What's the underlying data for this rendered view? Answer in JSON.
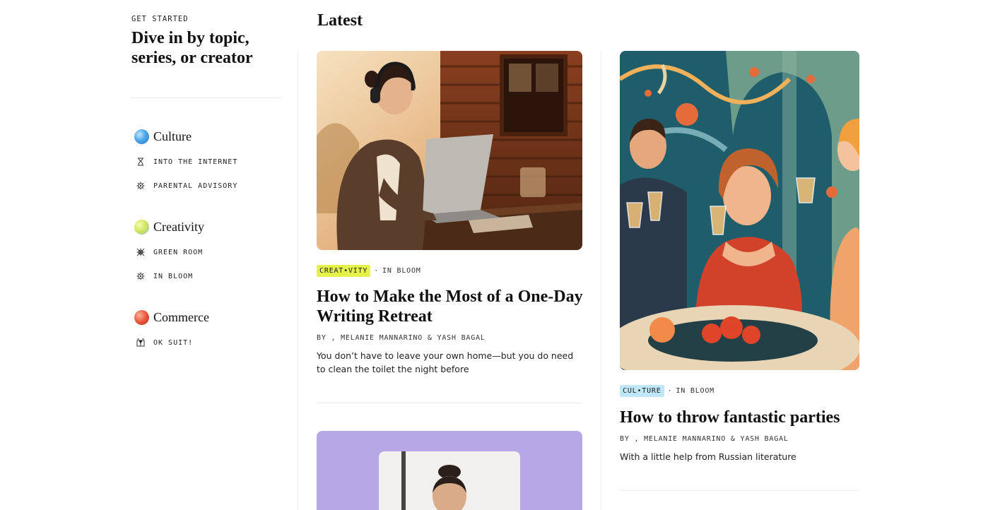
{
  "sidebar": {
    "eyebrow": "GET STARTED",
    "title": "Dive in by topic, series, or creator",
    "topics": [
      {
        "name": "Culture",
        "icon": "globe-icon",
        "color": "#4da6e8",
        "series": [
          {
            "name": "INTO THE INTERNET",
            "icon": "hourglass-icon"
          },
          {
            "name": "PARENTAL ADVISORY",
            "icon": "gear-icon"
          }
        ]
      },
      {
        "name": "Creativity",
        "icon": "globe-icon",
        "color": "#cfe35a",
        "series": [
          {
            "name": "GREEN ROOM",
            "icon": "grid-icon"
          },
          {
            "name": "IN BLOOM",
            "icon": "gear-icon"
          }
        ]
      },
      {
        "name": "Commerce",
        "icon": "globe-icon",
        "color": "#e8573c",
        "series": [
          {
            "name": "OK SUIT!",
            "icon": "suit-icon"
          }
        ]
      }
    ]
  },
  "main": {
    "title": "Latest",
    "articles": [
      {
        "tag": "CREAT•VITY",
        "tag_color": "#e4f24a",
        "series": "IN BLOOM",
        "headline": "How to Make the Most of a One-Day Writing Retreat",
        "byline": "BY , MELANIE MANNARINO & YASH BAGAL",
        "dek": "You don’t have to leave your own home—but you do need to clean the toilet the night before"
      },
      {
        "tag": "CUL•TURE",
        "tag_color": "#bfe7f7",
        "series": "IN BLOOM",
        "headline": "How to throw fantastic parties",
        "byline": "BY , MELANIE MANNARINO & YASH BAGAL",
        "dek": "With a little help from Russian literature"
      }
    ],
    "separator": "·"
  }
}
